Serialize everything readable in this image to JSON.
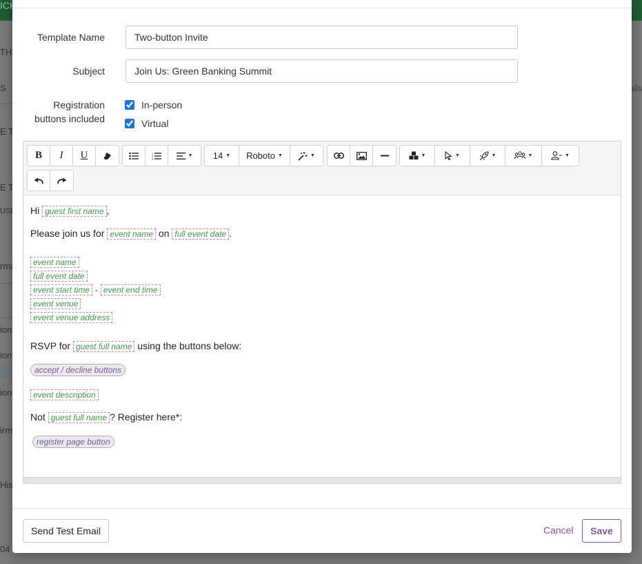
{
  "background": {
    "fragments": [
      "ICK",
      "TH",
      "S",
      "E T",
      "E T",
      "USE",
      "rma",
      "ion",
      "ion",
      "ion",
      "irm",
      "His",
      "04",
      "ails"
    ]
  },
  "form": {
    "template_name_label": "Template Name",
    "template_name_value": "Two-button Invite",
    "subject_label": "Subject",
    "subject_value": "Join Us: Green Banking Summit",
    "registration_label_line1": "Registration",
    "registration_label_line2": "buttons included",
    "in_person_label": "In-person",
    "virtual_label": "Virtual"
  },
  "toolbar": {
    "bold": "B",
    "italic": "I",
    "underline": "U",
    "font_size": "14",
    "font_family": "Roboto"
  },
  "content": {
    "hi": "Hi",
    "comma": ",",
    "please_join": "Please join us for",
    "on": "on",
    "period": ".",
    "dash": "-",
    "rsvp_for": "RSVP for",
    "using_buttons": "using the buttons below:",
    "not": "Not",
    "register_here": "? Register here*:",
    "tags": {
      "guest_first_name": "guest first name",
      "event_name": "event name",
      "full_event_date": "full event date",
      "event_start_time": "event start time",
      "event_end_time": "event end time",
      "event_venue": "event venue",
      "event_venue_address": "event venue address",
      "guest_full_name": "guest full name",
      "event_description": "event description"
    },
    "pills": {
      "accept_decline": "accept / decline buttons",
      "register_page": "register page button"
    }
  },
  "footer": {
    "send_test_label": "Send Test Email",
    "cancel_label": "Cancel",
    "save_label": "Save"
  },
  "colors": {
    "accent": "#7d559a",
    "tag_text": "#3f9b4a",
    "tag_border": "#b68bd4",
    "topbar": "#1e5e33"
  }
}
